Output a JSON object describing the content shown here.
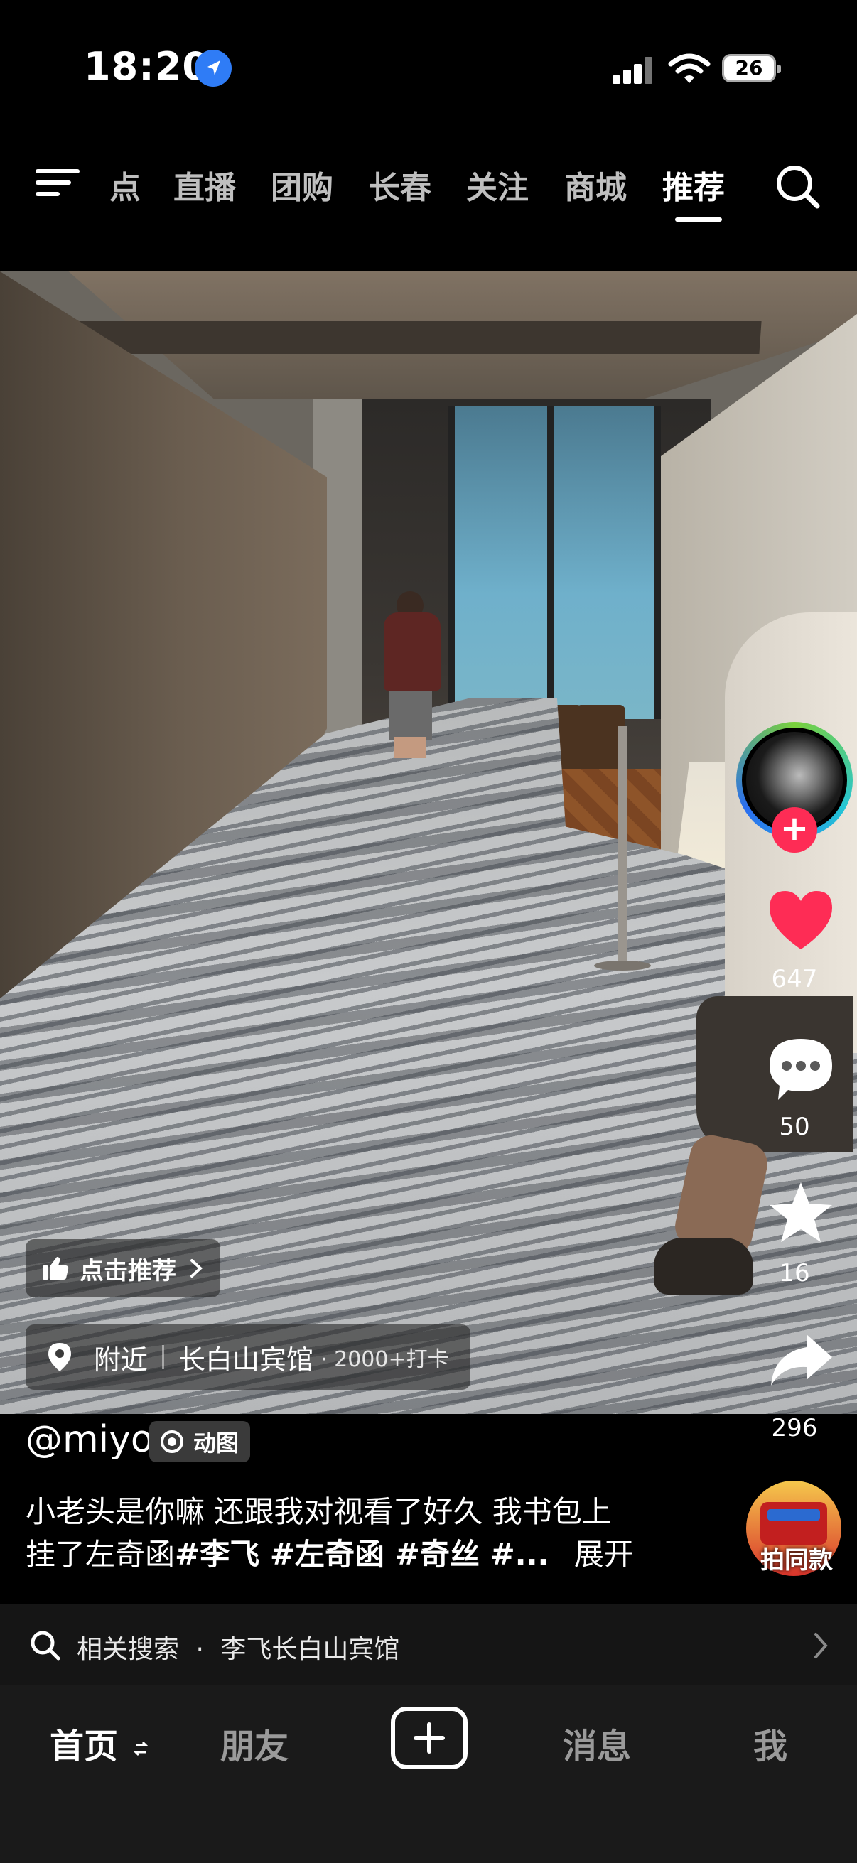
{
  "status_bar": {
    "time": "18:20",
    "battery": "26"
  },
  "top_nav": {
    "tabs": [
      "点",
      "直播",
      "团购",
      "长春",
      "关注",
      "商城",
      "推荐"
    ],
    "active_tab": "推荐"
  },
  "video": {
    "recommend_label": "点击推荐",
    "location": {
      "prefix": "附近",
      "place": "长白山宾馆",
      "checkins": "· 2000+打卡"
    }
  },
  "actions": {
    "likes": "647",
    "comments": "50",
    "favorites": "16",
    "shares": "296",
    "like_color": "#fe2c55"
  },
  "post": {
    "username": "@miyo",
    "badge": "动图",
    "caption_line1": "小老头是你嘛 还跟我对视看了好久 我书包上",
    "caption_line2_plain": "挂了左奇函",
    "caption_line2_tags": "#李飞 #左奇函 #奇丝 #...",
    "expand": "展开",
    "same_style": "拍同款"
  },
  "related_search": {
    "label": "相关搜索",
    "query": "李飞长白山宾馆"
  },
  "tab_bar": {
    "home": "首页",
    "friends": "朋友",
    "messages": "消息",
    "me": "我"
  }
}
